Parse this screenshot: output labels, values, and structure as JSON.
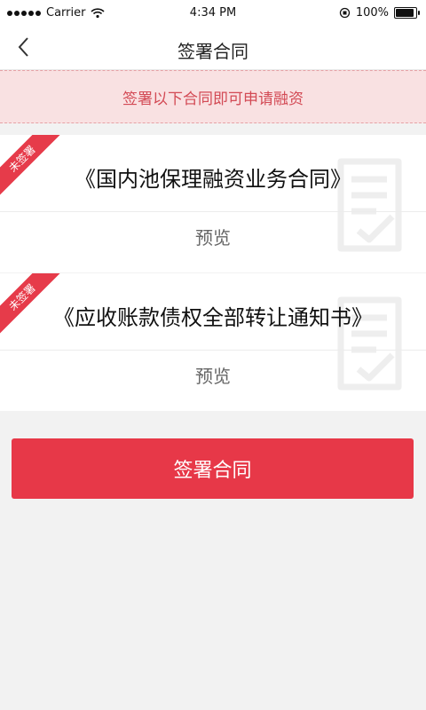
{
  "status_bar": {
    "carrier": "Carrier",
    "time": "4:34 PM",
    "battery": "100%",
    "battery_level": 1.0
  },
  "nav": {
    "title": "签署合同"
  },
  "notice": {
    "text": "签署以下合同即可申请融资"
  },
  "contracts": [
    {
      "status": "未签署",
      "title": "《国内池保理融资业务合同》",
      "preview_label": "预览"
    },
    {
      "status": "未签署",
      "title": "《应收账款债权全部转让通知书》",
      "preview_label": "预览"
    }
  ],
  "actions": {
    "sign_label": "签署合同"
  },
  "colors": {
    "accent": "#e73848",
    "notice_bg": "#f9e1e2",
    "notice_text": "#d34a55"
  }
}
